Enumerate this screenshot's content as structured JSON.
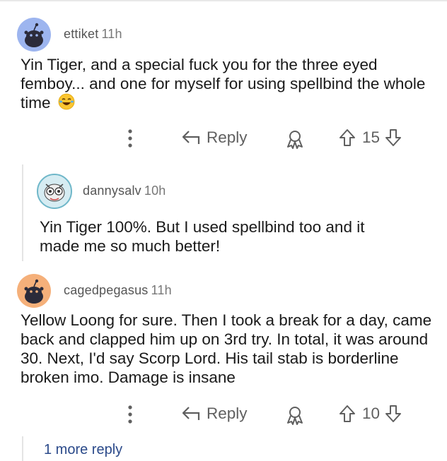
{
  "comments": [
    {
      "username": "ettiket",
      "time": "11h",
      "text": "Yin Tiger, and a special fuck you for the three eyed femboy... and one for myself for using spellbind the whole time",
      "emoji": "laughing-crying-emoji",
      "reply_label": "Reply",
      "votes": "15",
      "avatar_color": "#9db5ef"
    },
    {
      "username": "dannysalv",
      "time": "10h",
      "text": "Yin Tiger 100%. But I used spellbind too and it made me so much better!",
      "reply": true
    },
    {
      "username": "cagedpegasus",
      "time": "11h",
      "text": "Yellow Loong for sure. Then I took a break for a day, came back and clapped him up on 3rd try. In total, it was around 30. Next, I'd say Scorp Lord. His tail stab is borderline broken imo. Damage is insane",
      "reply_label": "Reply",
      "votes": "10",
      "avatar_color": "#f5b07a"
    }
  ],
  "more_replies": "1 more reply",
  "colors": {
    "text": "#1a1a1a",
    "muted": "#5f5f5f",
    "link": "#2b4a8a"
  }
}
